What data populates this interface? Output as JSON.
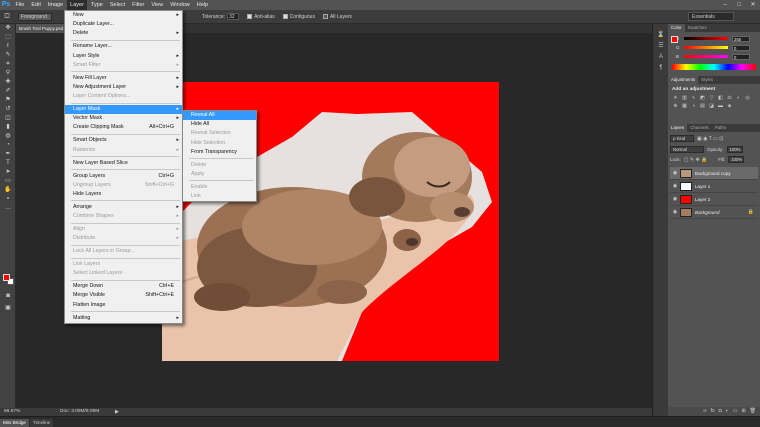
{
  "app": {
    "logo": "Ps",
    "menu": [
      "File",
      "Edit",
      "Image",
      "Layer",
      "Type",
      "Select",
      "Filter",
      "View",
      "Window",
      "Help"
    ],
    "active_menu": "Layer",
    "window_controls": [
      "–",
      "□",
      "✕"
    ]
  },
  "options_bar": {
    "fill_source": "Foreground",
    "tolerance_label": "Tolerance:",
    "tolerance_value": "32",
    "anti_alias": "Anti-alias",
    "contiguous": "Contiguous",
    "all_layers": "All Layers",
    "workspace": "Essentials"
  },
  "document": {
    "tab_title": "Brush Tool Puppy.psd",
    "zoom": "66.67%",
    "doc_size": "Doc: 3.09M/9.09M"
  },
  "bottom_tabs": [
    "Mini Bridge",
    "Timeline"
  ],
  "layer_menu": [
    {
      "label": "New",
      "arrow": true
    },
    {
      "label": "Duplicate Layer..."
    },
    {
      "label": "Delete",
      "arrow": true
    },
    {
      "sep": true
    },
    {
      "label": "Rename Layer..."
    },
    {
      "label": "Layer Style",
      "arrow": true
    },
    {
      "label": "Smart Filter",
      "arrow": true,
      "disabled": true
    },
    {
      "sep": true
    },
    {
      "label": "New Fill Layer",
      "arrow": true
    },
    {
      "label": "New Adjustment Layer",
      "arrow": true
    },
    {
      "label": "Layer Content Options...",
      "disabled": true
    },
    {
      "sep": true
    },
    {
      "label": "Layer Mask",
      "arrow": true,
      "highlight": true
    },
    {
      "label": "Vector Mask",
      "arrow": true
    },
    {
      "label": "Create Clipping Mask",
      "shortcut": "Alt+Ctrl+G"
    },
    {
      "sep": true
    },
    {
      "label": "Smart Objects",
      "arrow": true
    },
    {
      "label": "Rasterize",
      "arrow": true,
      "disabled": true
    },
    {
      "sep": true
    },
    {
      "label": "New Layer Based Slice"
    },
    {
      "sep": true
    },
    {
      "label": "Group Layers",
      "shortcut": "Ctrl+G"
    },
    {
      "label": "Ungroup Layers",
      "shortcut": "Shift+Ctrl+G",
      "disabled": true
    },
    {
      "label": "Hide Layers"
    },
    {
      "sep": true
    },
    {
      "label": "Arrange",
      "arrow": true
    },
    {
      "label": "Combine Shapes",
      "arrow": true,
      "disabled": true
    },
    {
      "sep": true
    },
    {
      "label": "Align",
      "arrow": true,
      "disabled": true
    },
    {
      "label": "Distribute",
      "arrow": true,
      "disabled": true
    },
    {
      "sep": true
    },
    {
      "label": "Lock All Layers in Group...",
      "disabled": true
    },
    {
      "sep": true
    },
    {
      "label": "Link Layers",
      "disabled": true
    },
    {
      "label": "Select Linked Layers",
      "disabled": true
    },
    {
      "sep": true
    },
    {
      "label": "Merge Down",
      "shortcut": "Ctrl+E"
    },
    {
      "label": "Merge Visible",
      "shortcut": "Shift+Ctrl+E"
    },
    {
      "label": "Flatten Image"
    },
    {
      "sep": true
    },
    {
      "label": "Matting",
      "arrow": true
    }
  ],
  "layer_mask_submenu": [
    {
      "label": "Reveal All",
      "highlight": true
    },
    {
      "label": "Hide All"
    },
    {
      "label": "Reveal Selection",
      "disabled": true
    },
    {
      "label": "Hide Selection",
      "disabled": true
    },
    {
      "label": "From Transparency"
    },
    {
      "sep": true
    },
    {
      "label": "Delete",
      "disabled": true
    },
    {
      "label": "Apply",
      "disabled": true
    },
    {
      "sep": true
    },
    {
      "label": "Enable",
      "disabled": true
    },
    {
      "label": "Link",
      "disabled": true
    }
  ],
  "color_panel": {
    "tabs": [
      "Color",
      "Swatches"
    ],
    "rows": [
      {
        "label": "R",
        "value": "255"
      },
      {
        "label": "G",
        "value": "0"
      },
      {
        "label": "B",
        "value": "0"
      }
    ]
  },
  "adjustments_panel": {
    "tabs": [
      "Adjustments",
      "Styles"
    ],
    "title": "Add an adjustment"
  },
  "layers_panel": {
    "tabs": [
      "Layers",
      "Channels",
      "Paths"
    ],
    "kind": "Kind",
    "blend_mode": "Normal",
    "opacity_label": "Opacity:",
    "opacity": "100%",
    "lock_label": "Lock:",
    "fill_label": "Fill:",
    "fill": "100%",
    "layers": [
      {
        "name": "Background copy",
        "selected": true
      },
      {
        "name": "Layer 1"
      },
      {
        "name": "Layer 2"
      },
      {
        "name": "Background"
      }
    ]
  },
  "colors": {
    "red": "#fe0000",
    "highlight": "#3399ff",
    "menu_bg": "#f0f0f0"
  }
}
